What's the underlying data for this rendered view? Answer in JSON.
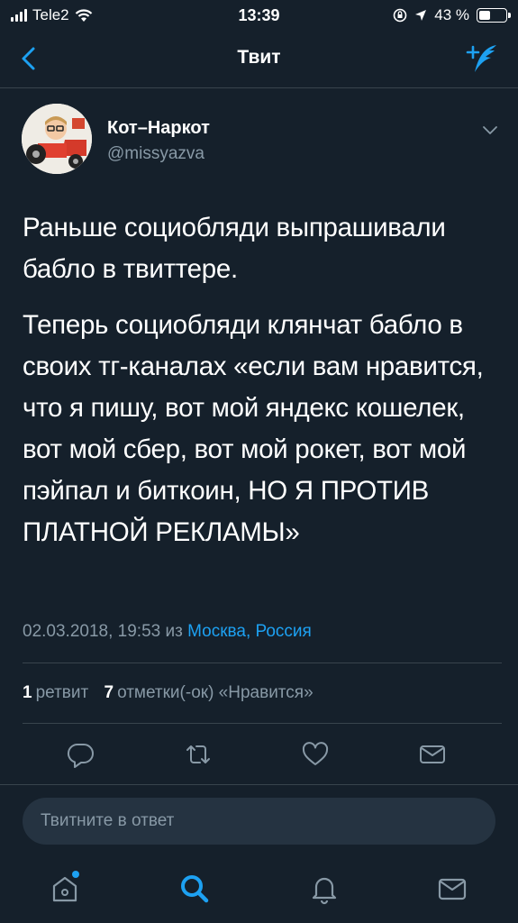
{
  "status_bar": {
    "carrier": "Tele2",
    "time": "13:39",
    "battery_text": "43 %",
    "battery_level": 0.43
  },
  "nav": {
    "title": "Твит",
    "back_icon": "chevron-left-icon",
    "compose_icon": "compose-tweet-icon"
  },
  "tweet": {
    "author_name": "Кот–Наркот",
    "author_handle": "@missyazva",
    "paragraphs": [
      "Раньше социобляди выпрашивали бабло в твиттере.",
      "Теперь социобляди клянчат бабло в своих тг-каналах «если вам нравится, что я пишу, вот мой яндекс кошелек, вот мой сбер, вот мой рокет, вот мой пэйпал и биткоин, НО Я ПРОТИВ ПЛАТНОЙ РЕКЛАМЫ»"
    ],
    "date": "02.03.2018, 19:53",
    "from": "из",
    "location": "Москва, Россия",
    "retweet_count": "1",
    "retweet_label": "ретвит",
    "likes_count": "7",
    "likes_label": "отметки(-ок) «Нравится»"
  },
  "reply": {
    "placeholder": "Твитните в ответ"
  },
  "colors": {
    "background": "#15202b",
    "accent": "#1da1f2",
    "secondary_text": "#8899a6",
    "divider": "#38444d"
  }
}
